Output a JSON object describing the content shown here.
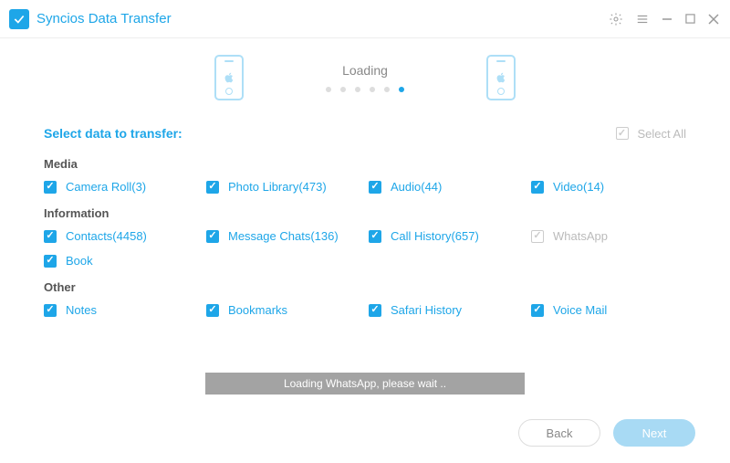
{
  "titlebar": {
    "brand": "Syncios Data Transfer"
  },
  "loading": {
    "label": "Loading",
    "dot_count": 6,
    "active_dot": 5
  },
  "select": {
    "title": "Select data to transfer:",
    "all_label": "Select All"
  },
  "sections": {
    "media": {
      "title": "Media",
      "items": [
        {
          "label": "Camera Roll(3)",
          "checked": true,
          "disabled": false
        },
        {
          "label": "Photo Library(473)",
          "checked": true,
          "disabled": false
        },
        {
          "label": "Audio(44)",
          "checked": true,
          "disabled": false
        },
        {
          "label": "Video(14)",
          "checked": true,
          "disabled": false
        }
      ]
    },
    "info": {
      "title": "Information",
      "items": [
        {
          "label": "Contacts(4458)",
          "checked": true,
          "disabled": false
        },
        {
          "label": "Message Chats(136)",
          "checked": true,
          "disabled": false
        },
        {
          "label": "Call History(657)",
          "checked": true,
          "disabled": false
        },
        {
          "label": "WhatsApp",
          "checked": true,
          "disabled": true
        },
        {
          "label": "Book",
          "checked": true,
          "disabled": false
        }
      ]
    },
    "other": {
      "title": "Other",
      "items": [
        {
          "label": "Notes",
          "checked": true,
          "disabled": false
        },
        {
          "label": "Bookmarks",
          "checked": true,
          "disabled": false
        },
        {
          "label": "Safari History",
          "checked": true,
          "disabled": false
        },
        {
          "label": "Voice Mail",
          "checked": true,
          "disabled": false
        }
      ]
    }
  },
  "progress": {
    "text": "Loading WhatsApp, please wait .."
  },
  "footer": {
    "back": "Back",
    "next": "Next"
  }
}
